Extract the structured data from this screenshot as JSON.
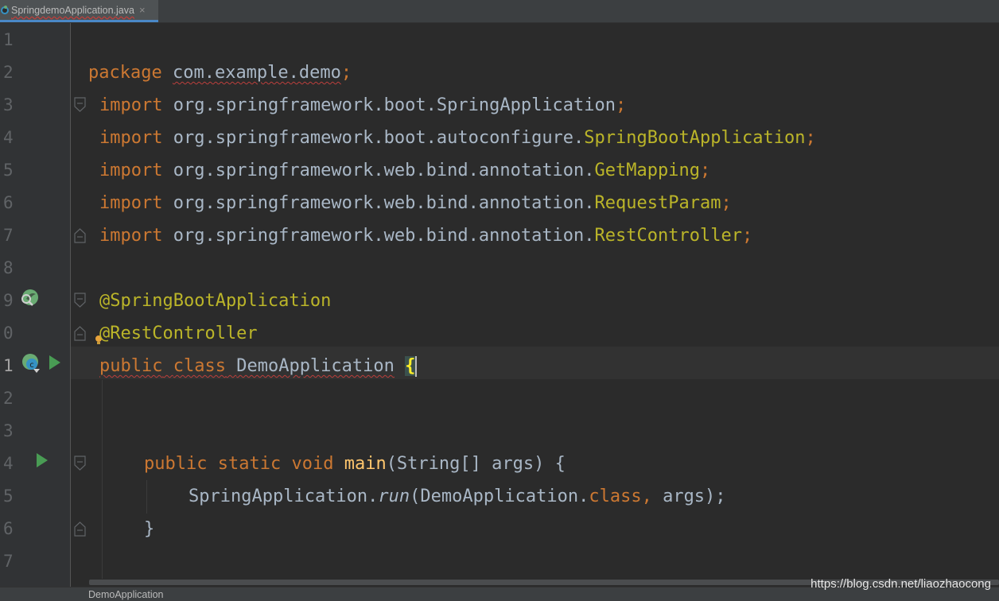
{
  "tab": {
    "filename": "SpringdemoApplication.java",
    "close": "×"
  },
  "line_numbers": [
    "1",
    "2",
    "3",
    "4",
    "5",
    "6",
    "7",
    "8",
    "9",
    "0",
    "1",
    "2",
    "3",
    "4",
    "5",
    "6",
    "7"
  ],
  "code": {
    "l2_package_kw": "package",
    "l2_package_name": "com.example.demo",
    "l2_semi": ";",
    "import_kw": "import",
    "l3_path": "org.springframework.boot.SpringApplication",
    "l4_path": "org.springframework.boot.autoconfigure.",
    "l4_cls": "SpringBootApplication",
    "l5_path": "org.springframework.web.bind.annotation.",
    "l5_cls": "GetMapping",
    "l6_path": "org.springframework.web.bind.annotation.",
    "l6_cls": "RequestParam",
    "l7_path": "org.springframework.web.bind.annotation.",
    "l7_cls": "RestController",
    "semi": ";",
    "l9_annotation": "@SpringBootApplication",
    "l10_annotation": "@RestController",
    "l11_public": "public",
    "l11_class": "class",
    "l11_name": "DemoApplication",
    "l11_brace": "{",
    "l14_public": "public",
    "l14_static": "static",
    "l14_void": "void",
    "l14_main": "main",
    "l14_params": "(String[] args) {",
    "l15_spring": "SpringApplication.",
    "l15_run": "run",
    "l15_open": "(DemoApplication.",
    "l15_class": "class",
    "l15_comma": ",",
    "l15_args": " args);",
    "l16_close": "}"
  },
  "breadcrumb": "DemoApplication",
  "watermark": "https://blog.csdn.net/liaozhaocong",
  "icons": {
    "tab": "java-class-icon",
    "spring_bean": "spring-bean-search-icon",
    "spring_run": "spring-boot-run-icon",
    "run": "run-arrow-icon",
    "fold": "fold-marker-icon",
    "bulb": "intention-bulb-icon"
  },
  "colors": {
    "editor_bg": "#2b2b2b",
    "keyword": "#cc7832",
    "annotation": "#bbb529",
    "function": "#ffc66d",
    "text": "#a9b7c6",
    "error_underline": "#bc3f3c",
    "accent": "#4a88c7"
  }
}
